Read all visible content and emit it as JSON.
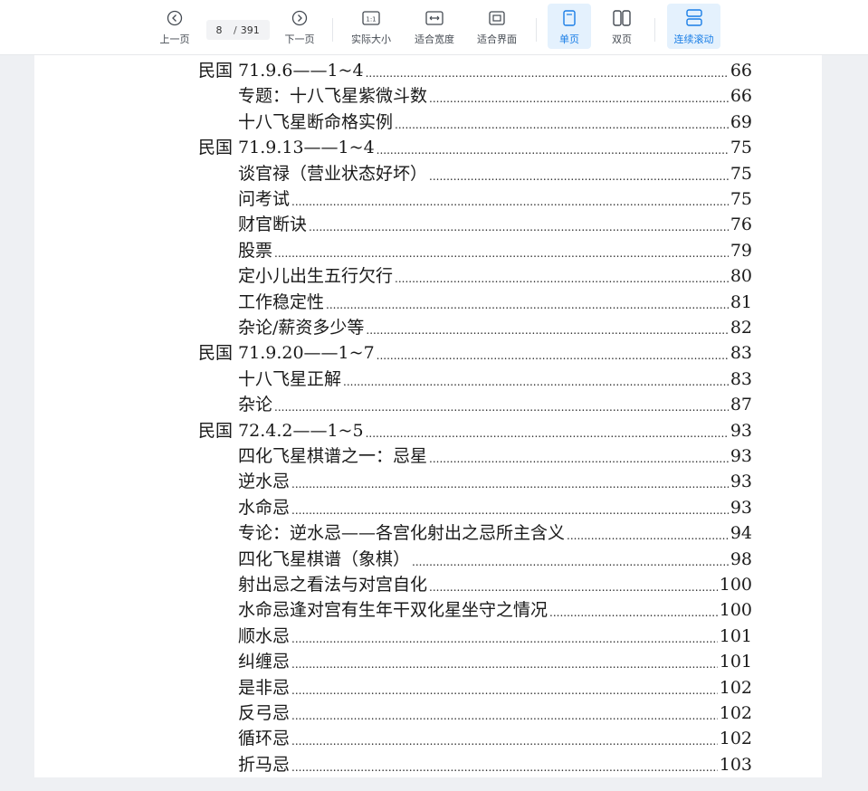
{
  "toolbar": {
    "prev_label": "上一页",
    "next_label": "下一页",
    "current_page": "8",
    "page_separator": "/",
    "total_pages": "391",
    "actual_size_label": "实际大小",
    "fit_width_label": "适合宽度",
    "fit_page_label": "适合界面",
    "single_page_label": "单页",
    "double_page_label": "双页",
    "continuous_label": "连续滚动",
    "accent_color": "#1a7ee6"
  },
  "toc": [
    {
      "title": "民国 71.9.6——1~4",
      "page": "66",
      "level": 1
    },
    {
      "title": "专题：十八飞星紫微斗数",
      "page": "66",
      "level": 2
    },
    {
      "title": "十八飞星断命格实例",
      "page": "69",
      "level": 2
    },
    {
      "title": "民国 71.9.13——1~4",
      "page": "75",
      "level": 1
    },
    {
      "title": "谈官禄（营业状态好坏）",
      "page": "75",
      "level": 2
    },
    {
      "title": "问考试",
      "page": "75",
      "level": 2
    },
    {
      "title": "财官断诀",
      "page": "76",
      "level": 2
    },
    {
      "title": "股票",
      "page": "79",
      "level": 2
    },
    {
      "title": "定小儿出生五行欠行",
      "page": "80",
      "level": 2
    },
    {
      "title": "工作稳定性",
      "page": "81",
      "level": 2
    },
    {
      "title": "杂论/薪资多少等",
      "page": "82",
      "level": 2
    },
    {
      "title": "民国 71.9.20——1~7",
      "page": "83",
      "level": 1
    },
    {
      "title": "十八飞星正解",
      "page": "83",
      "level": 2
    },
    {
      "title": "杂论",
      "page": "87",
      "level": 2
    },
    {
      "title": "民国 72.4.2——1~5",
      "page": "93",
      "level": 1
    },
    {
      "title": "四化飞星棋谱之一：忌星",
      "page": "93",
      "level": 2
    },
    {
      "title": "逆水忌",
      "page": "93",
      "level": 2
    },
    {
      "title": "水命忌",
      "page": "93",
      "level": 2
    },
    {
      "title": "专论：逆水忌——各宫化射出之忌所主含义",
      "page": "94",
      "level": 2
    },
    {
      "title": "四化飞星棋谱（象棋）",
      "page": "98",
      "level": 2
    },
    {
      "title": "射出忌之看法与对宫自化",
      "page": "100",
      "level": 2
    },
    {
      "title": "水命忌逢对宫有生年干双化星坐守之情况",
      "page": "100",
      "level": 2
    },
    {
      "title": "顺水忌",
      "page": "101",
      "level": 2
    },
    {
      "title": "纠缠忌",
      "page": "101",
      "level": 2
    },
    {
      "title": "是非忌",
      "page": "102",
      "level": 2
    },
    {
      "title": "反弓忌",
      "page": "102",
      "level": 2
    },
    {
      "title": "循环忌",
      "page": "102",
      "level": 2
    },
    {
      "title": "折马忌",
      "page": "103",
      "level": 2
    }
  ]
}
